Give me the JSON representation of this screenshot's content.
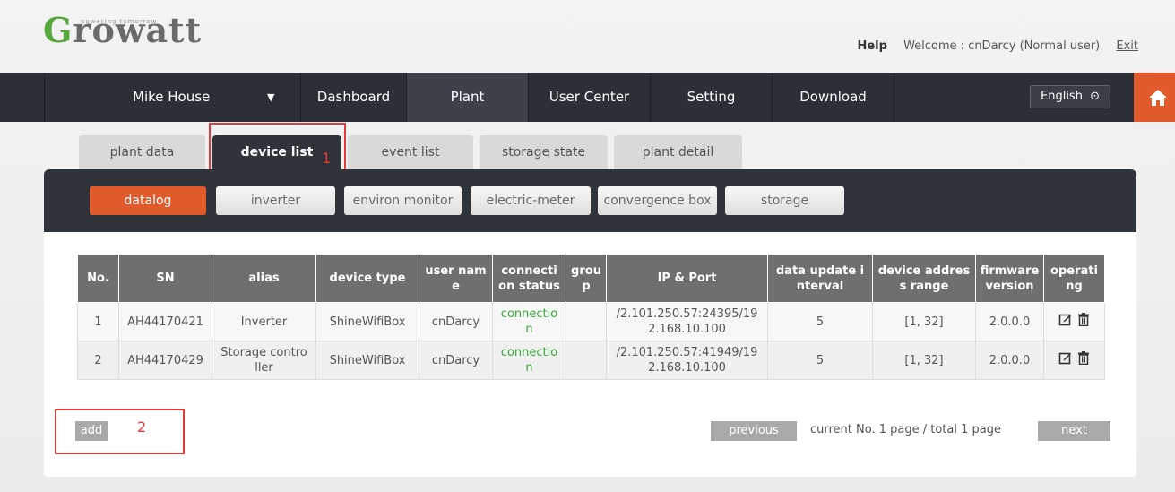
{
  "header": {
    "logo_text": "rowatt",
    "logo_letter": "G",
    "tagline": "powering tomorrow",
    "help": "Help",
    "welcome": "Welcome : cnDarcy (Normal user)",
    "exit": "Exit"
  },
  "nav": {
    "plant_select": "Mike House",
    "dashboard": "Dashboard",
    "plant": "Plant",
    "user_center": "User Center",
    "setting": "Setting",
    "download": "Download",
    "language": "English"
  },
  "tabs": [
    "plant data",
    "device list",
    "event list",
    "storage state",
    "plant detail"
  ],
  "sub_tabs": [
    "datalog",
    "inverter",
    "environ monitor",
    "electric-meter",
    "convergence box",
    "storage"
  ],
  "annotations": [
    "1",
    "2"
  ],
  "table": {
    "headers": [
      "No.",
      "SN",
      "alias",
      "device type",
      "user nam\ne",
      "connecti\non status",
      "grou\np",
      "IP & Port",
      "data update i\nnterval",
      "device addres\ns range",
      "firmware\nversion",
      "operati\nng"
    ],
    "rows": [
      [
        "1",
        "AH44170421",
        "Inverter",
        "ShineWifiBox",
        "cnDarcy",
        "connectio\nn",
        "",
        "/2.101.250.57:24395/19\n2.168.10.100",
        "5",
        "[1, 32]",
        "2.0.0.0"
      ],
      [
        "2",
        "AH44170429",
        "Storage contro\nller",
        "ShineWifiBox",
        "cnDarcy",
        "connectio\nn",
        "",
        "/2.101.250.57:41949/19\n2.168.10.100",
        "5",
        "[1, 32]",
        "2.0.0.0"
      ]
    ]
  },
  "footer": {
    "add": "add",
    "previous": "previous",
    "page_info": "current  No. 1 page / total 1 page",
    "next": "next"
  },
  "colors": {
    "accent": "#e05a2b",
    "nav_bg": "#2b2f36",
    "connection_green": "#3aa53a",
    "annotation_red": "#e23b3b"
  }
}
